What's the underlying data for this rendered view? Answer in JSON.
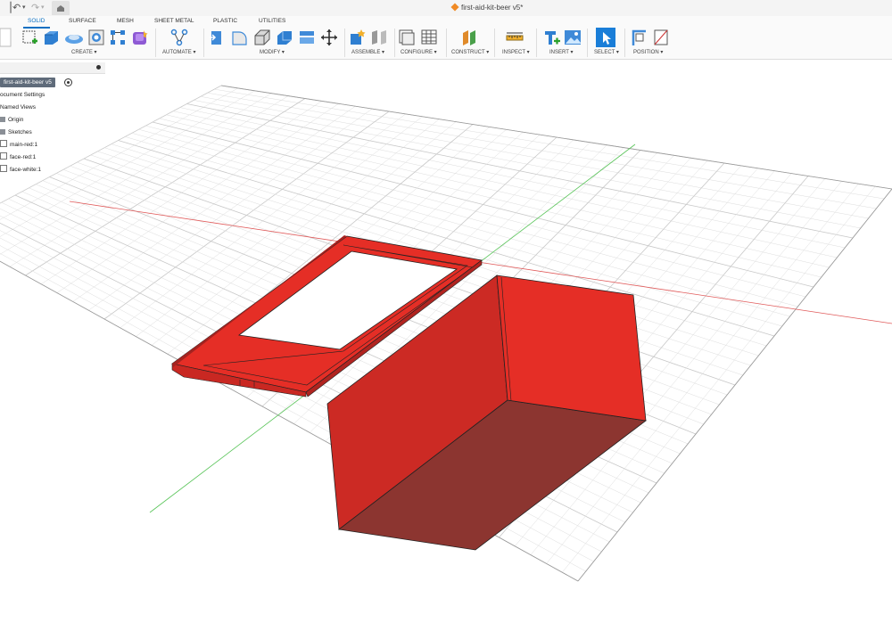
{
  "app": {
    "document_title": "first-aid-kit-beer v5*",
    "undo_glyph": "↶",
    "redo_glyph": "↷"
  },
  "tabs": [
    {
      "label": "SOLID",
      "active": true
    },
    {
      "label": "SURFACE",
      "active": false
    },
    {
      "label": "MESH",
      "active": false
    },
    {
      "label": "SHEET METAL",
      "active": false
    },
    {
      "label": "PLASTIC",
      "active": false
    },
    {
      "label": "UTILITIES",
      "active": false
    }
  ],
  "groups": {
    "create": "CREATE ▾",
    "automate": "AUTOMATE ▾",
    "modify": "MODIFY ▾",
    "assemble": "ASSEMBLE ▾",
    "configure": "CONFIGURE ▾",
    "construct": "CONSTRUCT ▾",
    "inspect": "INSPECT ▾",
    "insert": "INSERT ▾",
    "select": "SELECT ▾",
    "position": "POSITION ▾"
  },
  "browser": {
    "root": "first-aid-kit-beer v5",
    "items": [
      "ocument Settings",
      "Named Views",
      "Origin",
      "Sketches",
      "main-red:1",
      "face-red:1",
      "face-white:1"
    ]
  },
  "colors": {
    "accent": "#0a6fc2",
    "body_red": "#e52e26",
    "body_side": "#cc2a24",
    "body_dark": "#8c3530",
    "grid_line": "#dcdcdc",
    "x_axis": "#e05a5a",
    "y_axis": "#58c458"
  },
  "icons": [
    "new-component-icon",
    "create-sketch-icon",
    "extrude-icon",
    "revolve-icon",
    "hole-icon",
    "pattern-icon",
    "form-icon",
    "automate-icon",
    "press-pull-icon",
    "fillet-icon",
    "chamfer-icon",
    "shell-icon",
    "combine-icon",
    "move-icon",
    "new-component-assemble-icon",
    "joint-icon",
    "configure-icon",
    "table-icon",
    "offset-plane-icon",
    "measure-icon",
    "insert-icon",
    "canvas-icon",
    "select-icon",
    "align-icon",
    "capture-icon"
  ]
}
